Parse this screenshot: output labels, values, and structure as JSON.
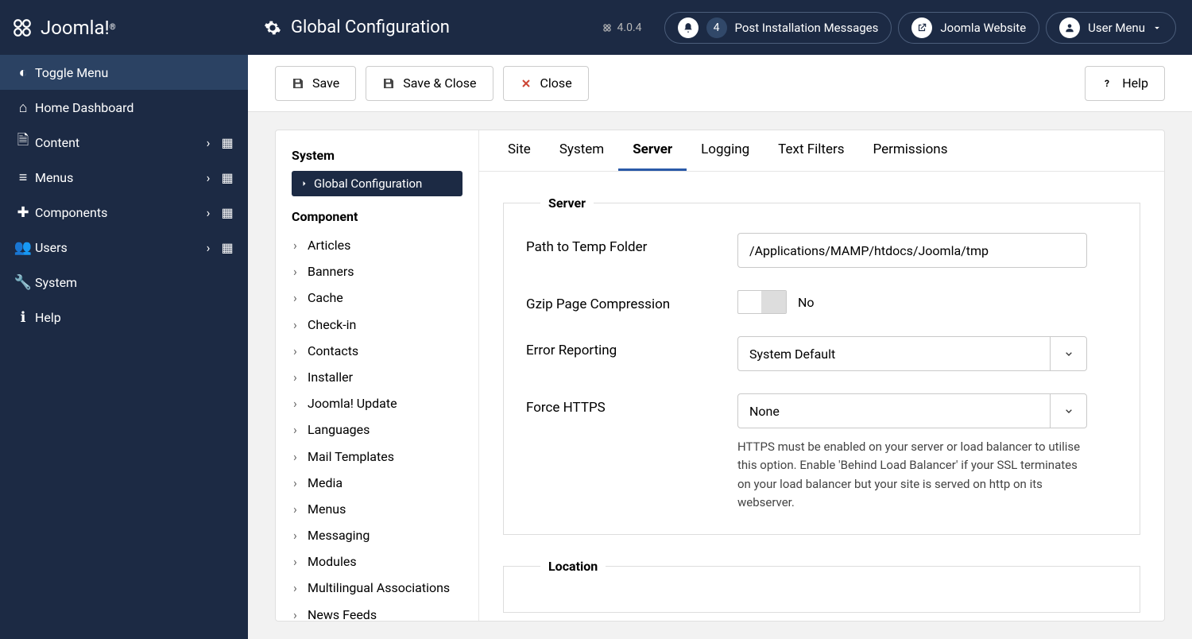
{
  "header": {
    "logo_text": "Joomla!",
    "title": "Global Configuration",
    "version": "4.0.4",
    "notify_count": "4",
    "post_install": "Post Installation Messages",
    "joomla_website": "Joomla Website",
    "user_menu": "User Menu"
  },
  "sidebar": {
    "toggle": "Toggle Menu",
    "items": [
      {
        "label": "Home Dashboard",
        "expandable": false
      },
      {
        "label": "Content",
        "expandable": true
      },
      {
        "label": "Menus",
        "expandable": true
      },
      {
        "label": "Components",
        "expandable": true
      },
      {
        "label": "Users",
        "expandable": true
      },
      {
        "label": "System",
        "expandable": false
      },
      {
        "label": "Help",
        "expandable": false
      }
    ]
  },
  "toolbar": {
    "save": "Save",
    "save_close": "Save & Close",
    "close": "Close",
    "help": "Help"
  },
  "left_tree": {
    "system_h": "System",
    "system_item": "Global Configuration",
    "component_h": "Component",
    "items": [
      "Articles",
      "Banners",
      "Cache",
      "Check-in",
      "Contacts",
      "Installer",
      "Joomla! Update",
      "Languages",
      "Mail Templates",
      "Media",
      "Menus",
      "Messaging",
      "Modules",
      "Multilingual Associations",
      "News Feeds"
    ]
  },
  "tabs": [
    "Site",
    "System",
    "Server",
    "Logging",
    "Text Filters",
    "Permissions"
  ],
  "active_tab": "Server",
  "form": {
    "server_legend": "Server",
    "location_legend": "Location",
    "tmp_label": "Path to Temp Folder",
    "tmp_value": "/Applications/MAMP/htdocs/Joomla/tmp",
    "gzip_label": "Gzip Page Compression",
    "gzip_value": "No",
    "error_label": "Error Reporting",
    "error_value": "System Default",
    "https_label": "Force HTTPS",
    "https_value": "None",
    "https_help": "HTTPS must be enabled on your server or load balancer to utilise this option. Enable 'Behind Load Balancer' if your SSL terminates on your load balancer but your site is served on http on its webserver."
  }
}
